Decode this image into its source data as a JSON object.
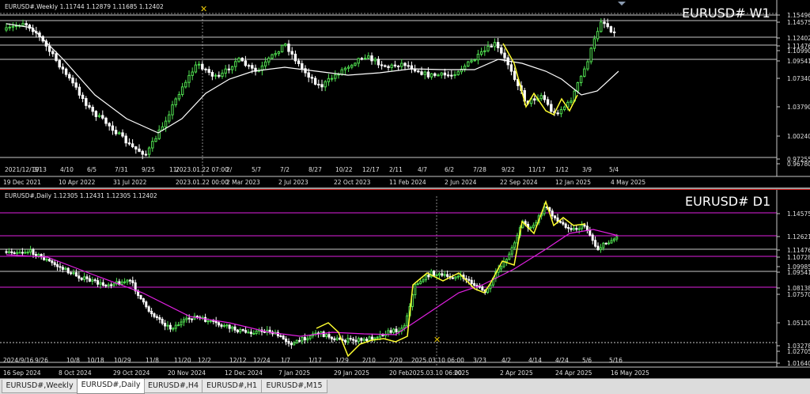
{
  "top_chart": {
    "info": "EURUSD#,Weekly  1.11744 1.12879 1.11685 1.12402",
    "label": "EURUSD# W1",
    "price_labels": [
      "1.15496",
      "1.14575",
      "1.12402",
      "1.11476",
      "1.10990",
      "1.09541",
      "1.07340",
      "1.03790",
      "1.00240",
      "0.97255",
      "0.96780"
    ],
    "date_labels": [
      "2021/12/19",
      "3/13",
      "4/10",
      "6/5",
      "7/31",
      "9/25",
      "11/",
      "2023.01.22 07:00",
      "2/",
      "5/7",
      "7/2",
      "8/27",
      "10/22",
      "12/17",
      "2/11",
      "4/7",
      "6/2",
      "7/28",
      "9/22",
      "11/17",
      "1/12",
      "3/9",
      "5/4"
    ],
    "bottom_date_labels": [
      "19 Dec 2021",
      "10 Apr 2022",
      "31 Jul 2022",
      "2023.01.22 00:00",
      "2 Mar 2023",
      "2 Jul 2023",
      "22 Oct 2023",
      "11 Feb 2024",
      "2 Jun 2024",
      "22 Sep 2024",
      "12 Jan 2025",
      "4 May 2025"
    ],
    "colors": {
      "bull": "#50e050",
      "bear": "#ffffff",
      "ma": "#ffffff",
      "zigzag": "#ffff30"
    }
  },
  "bottom_chart": {
    "info": "EURUSD#,Daily  1.12305 1.12431 1.12305 1.12402",
    "label": "EURUSD# D1",
    "price_labels": [
      "1.14575",
      "1.12621",
      "1.11476",
      "1.10728",
      "1.09985",
      "1.09541",
      "1.08138",
      "1.07570",
      "1.05120",
      "1.03278",
      "1.02705",
      "1.01640"
    ],
    "date_labels": [
      "2024/9/16",
      "9/26",
      "10/8",
      "10/18",
      "10/29",
      "11/8",
      "11/20",
      "12/2",
      "12/12",
      "12/24",
      "1/7",
      "1/17",
      "1/29",
      "2/10",
      "2/20",
      "2025.03.10 06:00",
      "3/23",
      "4/2",
      "4/14",
      "4/24",
      "5/6",
      "5/16"
    ],
    "bottom_date_labels": [
      "16 Sep 2024",
      "8 Oct 2024",
      "29 Oct 2024",
      "20 Nov 2024",
      "12 Dec 2024",
      "7 Jan 2025",
      "29 Jan 2025",
      "20 Feb",
      "2025.03.10 06:00",
      "2025",
      "2 Apr 2025",
      "24 Apr 2025",
      "16 May 2025"
    ],
    "colors": {
      "bull": "#50e050",
      "bear": "#ffffff",
      "ma": "#e020e0",
      "zigzag": "#ffff30",
      "level": "#e020e0"
    }
  },
  "tabs": [
    "EURUSD#,Weekly",
    "EURUSD#,Daily",
    "EURUSD#,H4",
    "EURUSD#,H1",
    "EURUSD#,M15"
  ],
  "active_tab": 1
}
